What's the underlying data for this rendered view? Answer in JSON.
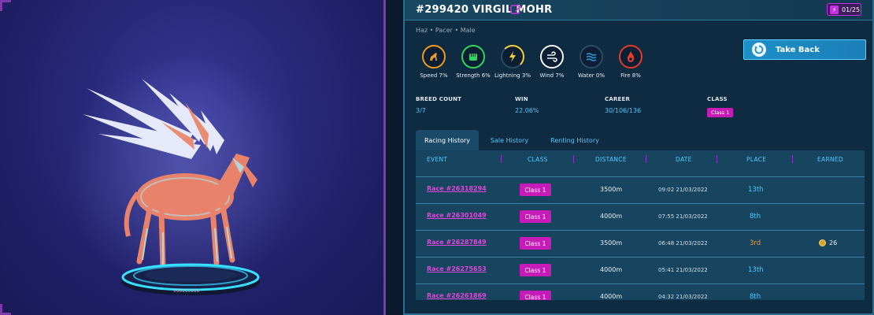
{
  "horse": {
    "title": "#299420 VIRGIL MOHR",
    "subtitle": "Haz  •  Pacer  •  Male",
    "energy": "01/25",
    "pedestal_label": "000000000"
  },
  "take_back": {
    "label": "Take Back"
  },
  "stats": [
    {
      "name": "Speed",
      "value": "7%",
      "label": "Speed  7%",
      "color": "#f09b24",
      "icon": "horse-icon",
      "ring_fill": 0.55
    },
    {
      "name": "Strength",
      "value": "6%",
      "label": "Strength  6%",
      "color": "#32d65a",
      "icon": "fist-icon",
      "ring_fill": 0.5
    },
    {
      "name": "Lightning",
      "value": "3%",
      "label": "Lightning  3%",
      "color": "#f4d23a",
      "icon": "lightning-icon",
      "ring_fill": 0.25
    },
    {
      "name": "Wind",
      "value": "7%",
      "label": "Wind  7%",
      "color": "#f1f4f7",
      "icon": "wind-icon",
      "ring_fill": 0.55
    },
    {
      "name": "Water",
      "value": "0%",
      "label": "Water  0%",
      "color": "#2a9bd9",
      "icon": "water-icon",
      "ring_fill": 0
    },
    {
      "name": "Fire",
      "value": "8%",
      "label": "Fire  8%",
      "color": "#e43b2d",
      "icon": "fire-icon",
      "ring_fill": 0.6
    }
  ],
  "info": {
    "breed_count_label": "BREED COUNT",
    "breed_count_value": "3/7",
    "win_label": "WIN",
    "win_value": "22.06%",
    "career_label": "CAREER",
    "career_value": "30/106/136",
    "class_label": "CLASS",
    "class_value": "Class 1"
  },
  "tabs": [
    {
      "label": "Racing History",
      "active": true
    },
    {
      "label": "Sale History",
      "active": false
    },
    {
      "label": "Renting History",
      "active": false
    }
  ],
  "table": {
    "headers": [
      "EVENT",
      "CLASS",
      "DISTANCE",
      "DATE",
      "PLACE",
      "EARNED"
    ],
    "rows": [
      {
        "event": "Race #26318294",
        "class": "Class 1",
        "distance": "3500m",
        "date": "09:02 21/03/2022",
        "place": "13th",
        "earned": ""
      },
      {
        "event": "Race #26301049",
        "class": "Class 1",
        "distance": "4000m",
        "date": "07:55 21/03/2022",
        "place": "8th",
        "earned": ""
      },
      {
        "event": "Race #26287849",
        "class": "Class 1",
        "distance": "3500m",
        "date": "06:48 21/03/2022",
        "place": "3rd",
        "earned": "26"
      },
      {
        "event": "Race #26275653",
        "class": "Class 1",
        "distance": "4000m",
        "date": "05:41 21/03/2022",
        "place": "13th",
        "earned": ""
      },
      {
        "event": "Race #26261869",
        "class": "Class 1",
        "distance": "4000m",
        "date": "04:32 21/03/2022",
        "place": "8th",
        "earned": ""
      }
    ]
  },
  "colors": {
    "accent_magenta": "#c61bb6",
    "accent_cyan": "#4fc9ff",
    "place_bronze": "#e59a45"
  }
}
